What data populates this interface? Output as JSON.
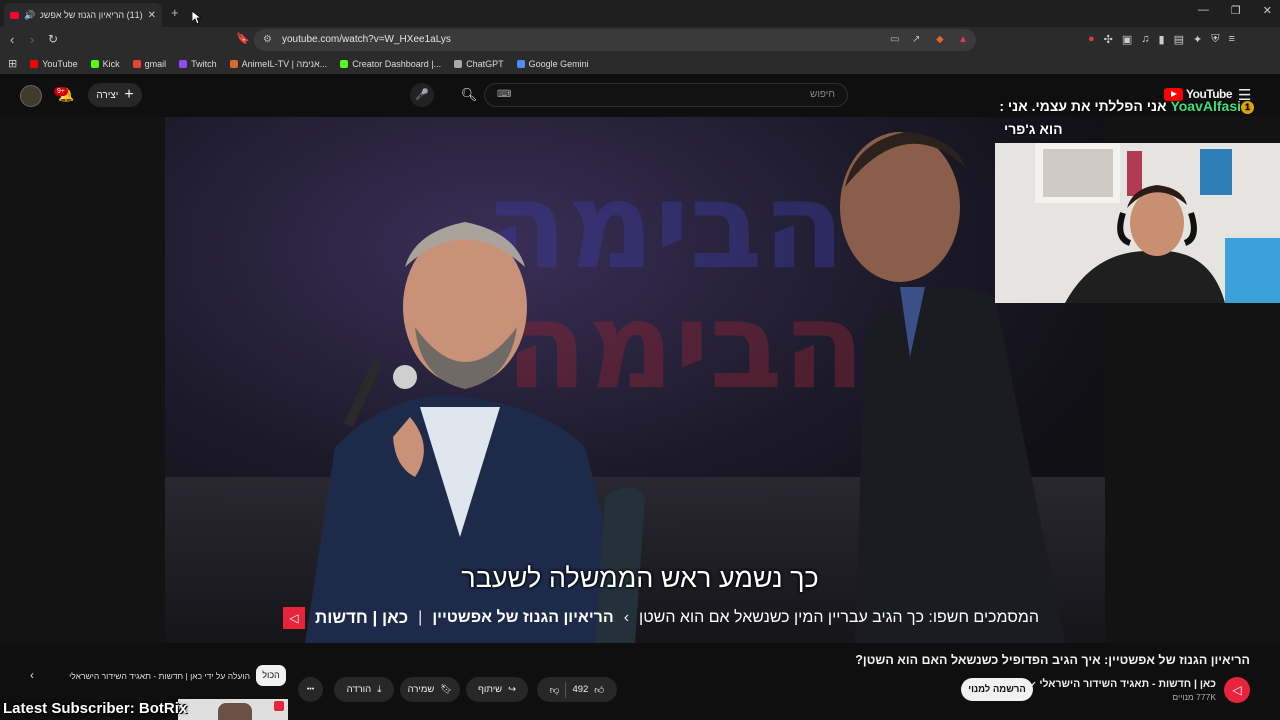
{
  "browser": {
    "tab_title": "(11) הריאיון הגנוז של אפשטיין",
    "url": "youtube.com/watch?v=W_HXee1aLys",
    "new_tab": "+",
    "window_controls": [
      "—",
      "❐",
      "✕"
    ]
  },
  "bookmarks": [
    {
      "label": "YouTube",
      "color": "#ff0000"
    },
    {
      "label": "Kick",
      "color": "#53fc18"
    },
    {
      "label": "gmail",
      "color": "#ea4335"
    },
    {
      "label": "Twitch",
      "color": "#9146ff"
    },
    {
      "label": "AnimeIL-TV | אנימה...",
      "color": "#d46b2a"
    },
    {
      "label": "Creator Dashboard |...",
      "color": "#53fc18"
    },
    {
      "label": "ChatGPT",
      "color": "#aaaaaa"
    },
    {
      "label": "Google Gemini",
      "color": "#4f8cf7"
    }
  ],
  "youtube": {
    "logo_text": "YouTube",
    "search_placeholder": "חיפוש",
    "create_label": "יצירה",
    "notif_count": "9+"
  },
  "video": {
    "subtitle": "כך נשמע ראש הממשלה לשעבר",
    "chyron_brand": "כאן | חדשות",
    "chyron_sep": "|",
    "chyron_show": "הריאיון הגנוז של אפשטיין",
    "chyron_arrow": "›",
    "chyron_text": "המסמכים חשפו: כך הגיב עבריין המין כשנשאל אם הוא השטן",
    "title": "הריאיון הגנוז של אפשטיין: איך הגיב הפדופיל כשנשאל האם הוא השטן?",
    "channel_name": "כאן | חדשות - תאגיד השידור הישראלי",
    "channel_subs": "777K מנויים",
    "subscribe": "הרשמה למנוי",
    "likes": "492",
    "share": "שיתוף",
    "save": "שמירה",
    "download": "הורדה",
    "more": "•••",
    "chip_all": "הכול",
    "chip_uploaded": "הועלה על ידי כאן | חדשות - תאגיד השידור הישראלי"
  },
  "overlay": {
    "alert_prefix": "אני הפללתי את עצמי. אני : ",
    "alert_user": "YoavAlfasi",
    "alert_num": "1",
    "alert_line2": "הוא ג'פרי",
    "latest_sub": "Latest Subscriber: BotRix"
  },
  "colors": {
    "yt_red": "#ff0000",
    "kan_red": "#e8243c",
    "alert_green": "#3fe07a"
  }
}
